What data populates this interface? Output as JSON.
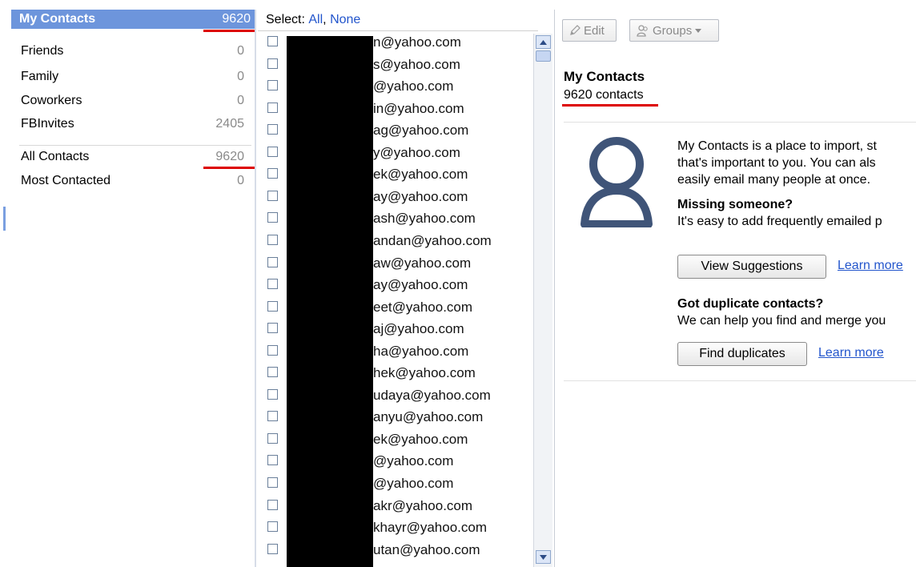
{
  "sidebar": {
    "header": {
      "label": "My Contacts",
      "count": "9620"
    },
    "groups": [
      {
        "label": "Friends",
        "count": "0"
      },
      {
        "label": "Family",
        "count": "0"
      },
      {
        "label": "Coworkers",
        "count": "0"
      },
      {
        "label": "FBInvites",
        "count": "2405"
      }
    ],
    "system": [
      {
        "label": "All Contacts",
        "count": "9620"
      },
      {
        "label": "Most Contacted",
        "count": "0"
      }
    ]
  },
  "list": {
    "select_label": "Select:",
    "select_all": "All",
    "select_sep": ",",
    "select_none": "None",
    "emails": [
      "n@yahoo.com",
      "s@yahoo.com",
      "@yahoo.com",
      "in@yahoo.com",
      "ag@yahoo.com",
      "y@yahoo.com",
      "ek@yahoo.com",
      "ay@yahoo.com",
      "ash@yahoo.com",
      "andan@yahoo.com",
      "aw@yahoo.com",
      "ay@yahoo.com",
      "eet@yahoo.com",
      "aj@yahoo.com",
      "ha@yahoo.com",
      "hek@yahoo.com",
      "udaya@yahoo.com",
      "anyu@yahoo.com",
      "ek@yahoo.com",
      "@yahoo.com",
      "@yahoo.com",
      "akr@yahoo.com",
      "khayr@yahoo.com",
      "utan@yahoo.com"
    ]
  },
  "detail": {
    "edit_label": "Edit",
    "groups_label": "Groups",
    "title": "My Contacts",
    "count_text": "9620 contacts",
    "intro_1": "My Contacts is a place to import, st",
    "intro_2": "that's important to you. You can als",
    "intro_3": "easily email many people at once.",
    "missing_heading": "Missing someone?",
    "missing_text": "It's easy to add frequently emailed p",
    "view_suggestions": "View Suggestions",
    "learn_more_1": "Learn more",
    "dup_heading": "Got duplicate contacts?",
    "dup_text": "We can help you find and merge you",
    "find_duplicates": "Find duplicates",
    "learn_more_2": "Learn more"
  },
  "colors": {
    "header_bg": "#6d95dc",
    "link": "#2255cc",
    "annotation": "#dd0000",
    "avatar": "#3f5478"
  }
}
